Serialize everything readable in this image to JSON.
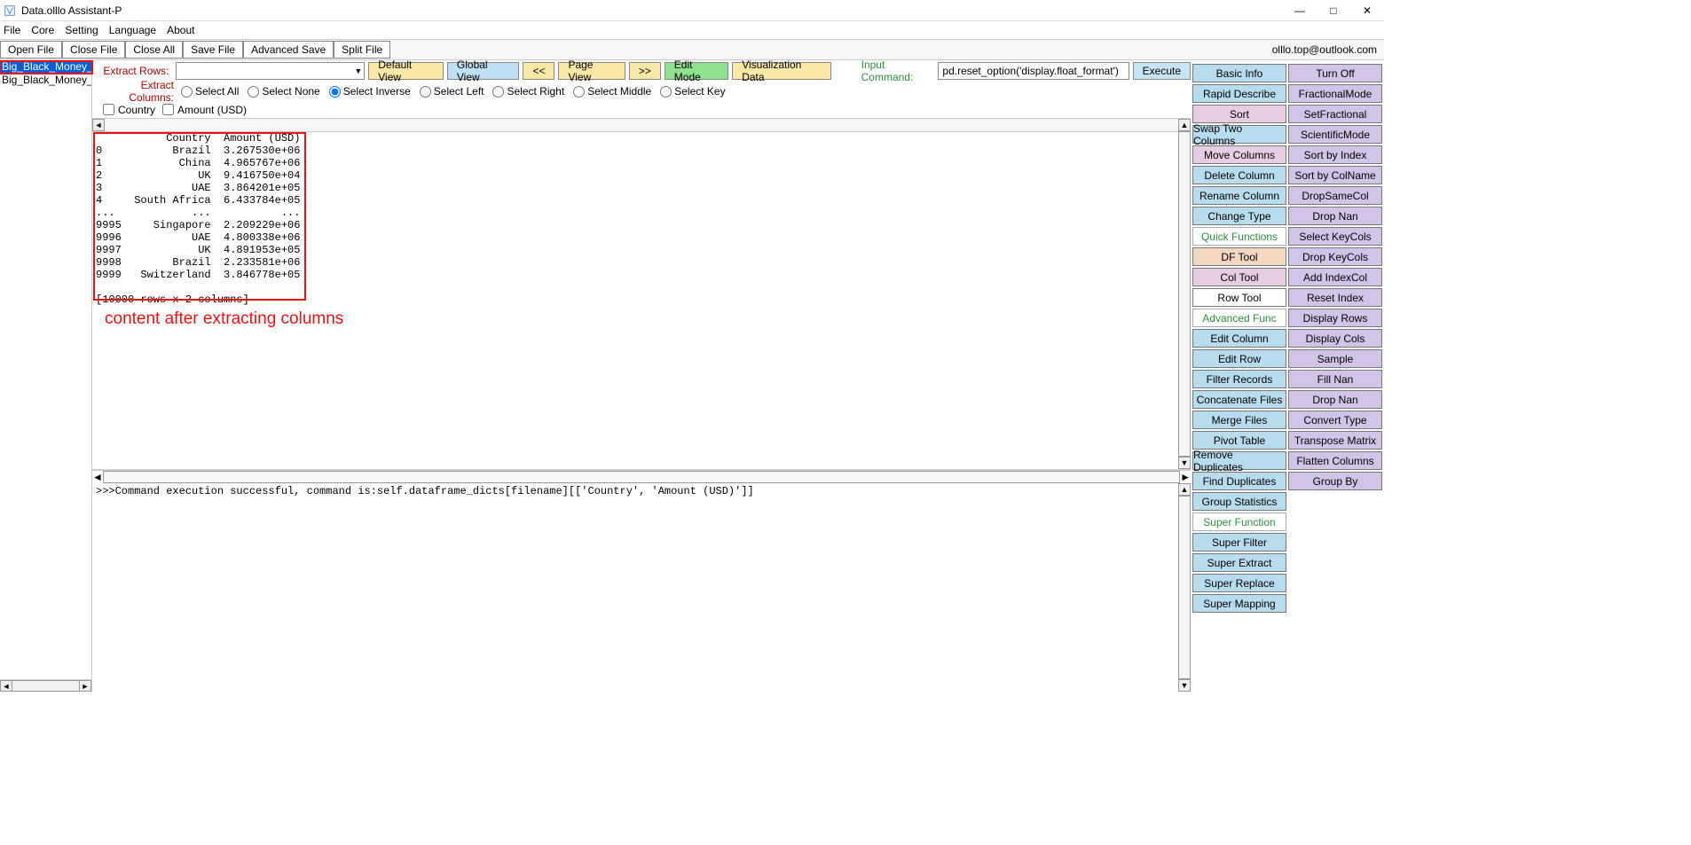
{
  "window": {
    "title": "Data.olllo Assistant-P"
  },
  "menu": {
    "file": "File",
    "core": "Core",
    "setting": "Setting",
    "language": "Language",
    "about": "About"
  },
  "toolbar": {
    "open_file": "Open File",
    "close_file": "Close File",
    "close_all": "Close All",
    "save_file": "Save File",
    "advanced_save": "Advanced Save",
    "split_file": "Split File",
    "email": "olllo.top@outlook.com"
  },
  "sidebar": {
    "items": [
      {
        "label": "Big_Black_Money_Data"
      },
      {
        "label": "Big_Black_Money_Data"
      }
    ]
  },
  "extract_rows_label": "Extract Rows:",
  "extract_cols_label": "Extract Columns:",
  "view_buttons": {
    "default_view": "Default View",
    "global_view": "Global View",
    "prev": "<<",
    "page_view": "Page View",
    "next": ">>",
    "edit_mode": "Edit Mode",
    "visualization": "Visualization Data"
  },
  "input_command_label": "Input Command:",
  "input_command_value": "pd.reset_option('display.float_format')",
  "execute_label": "Execute",
  "radios": {
    "select_all": "Select All",
    "select_none": "Select None",
    "select_inverse": "Select Inverse",
    "select_left": "Select Left",
    "select_right": "Select Right",
    "select_middle": "Select Middle",
    "select_key": "Select Key"
  },
  "checks": {
    "country": "Country",
    "amount": "Amount (USD)"
  },
  "data_output": "           Country  Amount (USD)\n0           Brazil  3.267530e+06\n1            China  4.965767e+06\n2               UK  9.416750e+04\n3              UAE  3.864201e+05\n4     South Africa  6.433784e+05\n...            ...           ...\n9995     Singapore  2.209229e+06\n9996           UAE  4.800338e+06\n9997            UK  4.891953e+05\n9998        Brazil  2.233581e+06\n9999   Switzerland  3.846778e+05\n\n[10000 rows x 2 columns]",
  "annotation_text": "content after extracting columns",
  "console_output": ">>>Command execution successful, command is:self.dataframe_dicts[filename][['Country', 'Amount (USD)']]",
  "right_col1": [
    {
      "label": "Basic Info",
      "cls": "blue"
    },
    {
      "label": "Rapid Describe",
      "cls": "blue"
    },
    {
      "label": "Sort",
      "cls": "pink"
    },
    {
      "label": "Swap Two Columns",
      "cls": "blue"
    },
    {
      "label": "Move Columns",
      "cls": "pink"
    },
    {
      "label": "Delete Column",
      "cls": "blue"
    },
    {
      "label": "Rename Column",
      "cls": "blue"
    },
    {
      "label": "Change Type",
      "cls": "blue"
    },
    {
      "label": "Quick Functions",
      "cls": "cat"
    },
    {
      "label": "DF Tool",
      "cls": "peach"
    },
    {
      "label": "Col Tool",
      "cls": "pink"
    },
    {
      "label": "Row Tool",
      "cls": ""
    },
    {
      "label": "Advanced Func",
      "cls": "cat"
    },
    {
      "label": "Edit Column",
      "cls": "blue"
    },
    {
      "label": "Edit Row",
      "cls": "blue"
    },
    {
      "label": "Filter Records",
      "cls": "blue"
    },
    {
      "label": "Concatenate Files",
      "cls": "blue"
    },
    {
      "label": "Merge Files",
      "cls": "blue"
    },
    {
      "label": "Pivot Table",
      "cls": "blue"
    },
    {
      "label": "Remove Duplicates",
      "cls": "blue"
    },
    {
      "label": "Find Duplicates",
      "cls": "blue"
    },
    {
      "label": "Group Statistics",
      "cls": "blue"
    },
    {
      "label": "Super Function",
      "cls": "cat"
    },
    {
      "label": "Super Filter",
      "cls": "blue"
    },
    {
      "label": "Super Extract",
      "cls": "blue"
    },
    {
      "label": "Super Replace",
      "cls": "blue"
    },
    {
      "label": "Super Mapping",
      "cls": "blue"
    }
  ],
  "right_col2": [
    {
      "label": "Turn Off",
      "cls": "purple"
    },
    {
      "label": "FractionalMode",
      "cls": "purple"
    },
    {
      "label": "SetFractional",
      "cls": "purple"
    },
    {
      "label": "ScientificMode",
      "cls": "purple"
    },
    {
      "label": "Sort by Index",
      "cls": "purple"
    },
    {
      "label": "Sort by ColName",
      "cls": "purple"
    },
    {
      "label": "DropSameCol",
      "cls": "purple"
    },
    {
      "label": "Drop Nan",
      "cls": "purple"
    },
    {
      "label": "Select KeyCols",
      "cls": "purple"
    },
    {
      "label": "Drop KeyCols",
      "cls": "purple"
    },
    {
      "label": "Add IndexCol",
      "cls": "purple"
    },
    {
      "label": "Reset Index",
      "cls": "purple"
    },
    {
      "label": "Display Rows",
      "cls": "purple"
    },
    {
      "label": "Display Cols",
      "cls": "purple"
    },
    {
      "label": "Sample",
      "cls": "purple"
    },
    {
      "label": "Fill Nan",
      "cls": "purple"
    },
    {
      "label": "Drop Nan",
      "cls": "purple"
    },
    {
      "label": "Convert Type",
      "cls": "purple"
    },
    {
      "label": "Transpose Matrix",
      "cls": "purple"
    },
    {
      "label": "Flatten Columns",
      "cls": "purple"
    },
    {
      "label": "Group By",
      "cls": "purple"
    }
  ]
}
